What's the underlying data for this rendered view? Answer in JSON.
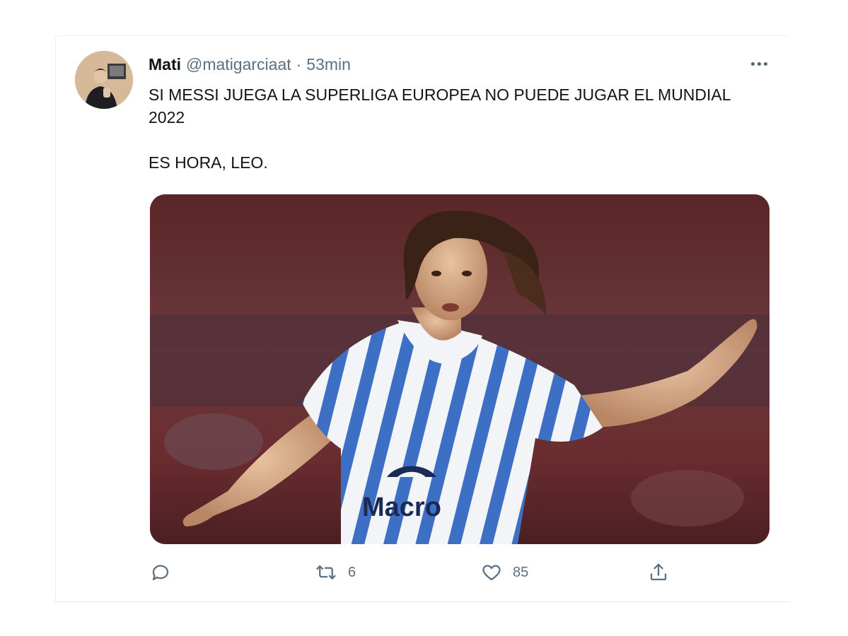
{
  "tweet": {
    "author_name": "Mati",
    "author_handle": "@matigarciaat",
    "separator": "·",
    "time": "53min",
    "text": "SI MESSI JUEGA LA SUPERLIGA EUROPEA NO PUEDE JUGAR EL MUNDIAL 2022\n\nES HORA, LEO.",
    "media": {
      "sponsor_text": "Macro"
    },
    "actions": {
      "reply_count": "",
      "retweet_count": "6",
      "like_count": "85"
    }
  },
  "icons": {
    "more": "more-horizontal-icon",
    "reply": "reply-icon",
    "retweet": "retweet-icon",
    "like": "heart-icon",
    "share": "share-icon"
  },
  "colors": {
    "text_primary": "#0f1419",
    "text_secondary": "#5b7083",
    "jersey_stripe": "#3d6fc4",
    "background_maroon": "#5a2a2c"
  }
}
